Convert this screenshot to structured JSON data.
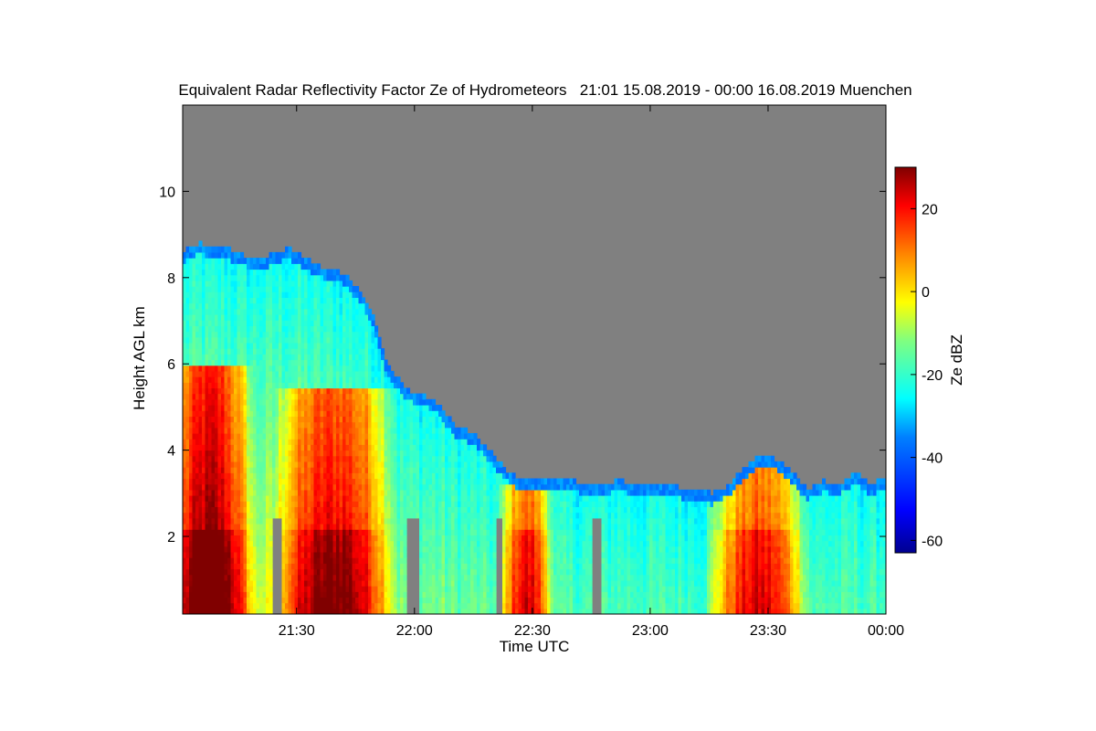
{
  "chart_data": {
    "type": "heatmap",
    "title": "Equivalent Radar Reflectivity Factor Ze of Hydrometeors   21:01 15.08.2019 - 00:00 16.08.2019 Muenchen",
    "xlabel": "Time UTC",
    "ylabel": "Height AGL km",
    "colorbar_label": "Ze dBZ",
    "x_ticks": [
      "21:30",
      "22:00",
      "22:30",
      "23:00",
      "23:30",
      "00:00"
    ],
    "x_tick_minutes": [
      30,
      60,
      90,
      120,
      150,
      180
    ],
    "xlim_minutes": [
      1,
      180
    ],
    "y_ticks": [
      2,
      4,
      6,
      8,
      10
    ],
    "ylim": [
      0.2,
      12.0
    ],
    "colorbar_ticks": [
      20,
      0,
      -20,
      -40,
      -60
    ],
    "colorbar_range": [
      -63,
      30
    ],
    "background_color": "#808080",
    "colormap": [
      "#00008f",
      "#0000ff",
      "#0080ff",
      "#00ffff",
      "#80ff80",
      "#ffff00",
      "#ff8000",
      "#ff0000",
      "#800000"
    ],
    "echo_top_profile": {
      "time_minutes": [
        1,
        5,
        12,
        20,
        28,
        35,
        42,
        47,
        50,
        53,
        58,
        62,
        66,
        70,
        75,
        80,
        84,
        88,
        94,
        100,
        106,
        112,
        118,
        124,
        130,
        136,
        140,
        144,
        148,
        152,
        156,
        160,
        164,
        168,
        172,
        176,
        180
      ],
      "top_km": [
        8.6,
        8.8,
        8.7,
        8.4,
        8.7,
        8.3,
        8.1,
        7.6,
        7.0,
        6.0,
        5.4,
        5.3,
        5.1,
        4.6,
        4.4,
        3.9,
        3.5,
        3.3,
        3.4,
        3.3,
        3.2,
        3.3,
        3.2,
        3.2,
        3.1,
        3.0,
        3.2,
        3.6,
        3.9,
        3.8,
        3.5,
        3.1,
        3.3,
        3.2,
        3.5,
        3.2,
        3.4
      ]
    },
    "reflectivity_cores": [
      {
        "start_min": 1,
        "end_min": 15,
        "top_km": 6.0,
        "max_dbz": 28
      },
      {
        "start_min": 30,
        "end_min": 50,
        "top_km": 5.5,
        "max_dbz": 22
      },
      {
        "start_min": 84,
        "end_min": 93,
        "top_km": 3.2,
        "max_dbz": 26
      },
      {
        "start_min": 139,
        "end_min": 156,
        "top_km": 3.8,
        "max_dbz": 24
      }
    ],
    "melting_layer_km": 2.2
  }
}
